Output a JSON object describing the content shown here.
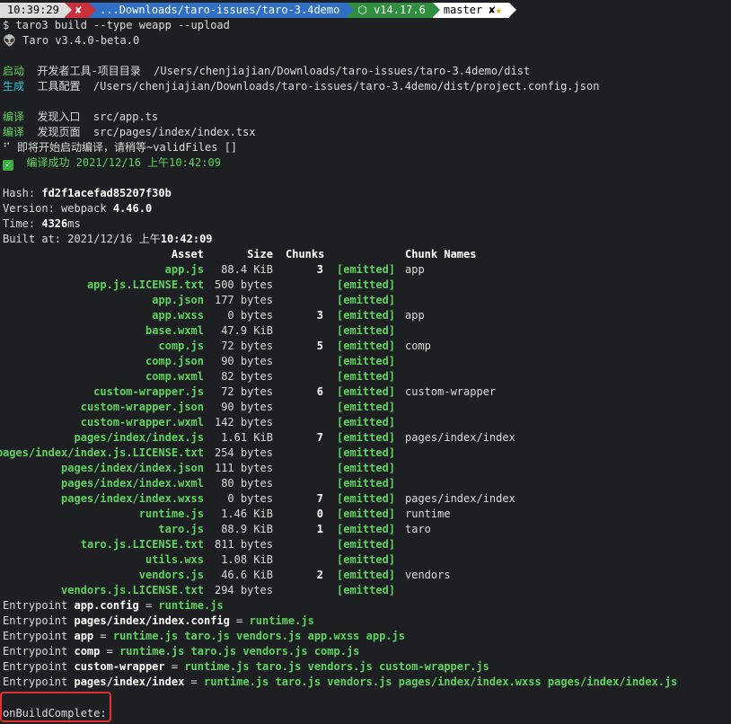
{
  "prompt": {
    "time": "10:39:29",
    "error_glyph": "✘",
    "path": "...Downloads/taro-issues/taro-3.4demo",
    "node_glyph": "⬡",
    "node_version": "v14.17.6",
    "branch_glyph": "",
    "branch": "master ✘",
    "star": "★"
  },
  "command": "$ taro3 build --type weapp --upload",
  "taro_version": "👽 Taro v3.4.0-beta.0",
  "launch": {
    "tag": "启动",
    "text": "  开发者工具-项目目录  /Users/chenjiajian/Downloads/taro-issues/taro-3.4demo/dist"
  },
  "generate": {
    "tag": "生成",
    "text": "  工具配置  /Users/chenjiajian/Downloads/taro-issues/taro-3.4demo/dist/project.config.json"
  },
  "compile1": {
    "tag": "编译",
    "text": "  发现入口  src/app.ts"
  },
  "compile2": {
    "tag": "编译",
    "text": "  发现页面  src/pages/index/index.tsx"
  },
  "waiting": "⠋ 即将开始启动编译，请稍等~validFiles []",
  "success": {
    "icon": "✓",
    "text": "  编译成功 2021/12/16 上午10:42:09"
  },
  "hash": {
    "label": "Hash: ",
    "value": "fd2f1acefad85207f30b"
  },
  "version": {
    "label": "Version: webpack ",
    "value": "4.46.0"
  },
  "time": {
    "label": "Time: ",
    "value": "4326",
    "unit": "ms"
  },
  "built": {
    "label": "Built at: 2021/12/16 上午",
    "value": "10:42:09"
  },
  "table": {
    "headers": {
      "asset": "Asset",
      "size": "Size",
      "chunks": "Chunks",
      "chunk_names": "Chunk Names"
    },
    "rows": [
      {
        "asset": "app.js",
        "size": "88.4 KiB",
        "chunks": "3",
        "emitted": "[emitted]",
        "name": "app"
      },
      {
        "asset": "app.js.LICENSE.txt",
        "size": "500 bytes",
        "chunks": "",
        "emitted": "[emitted]",
        "name": ""
      },
      {
        "asset": "app.json",
        "size": "177 bytes",
        "chunks": "",
        "emitted": "[emitted]",
        "name": ""
      },
      {
        "asset": "app.wxss",
        "size": "0 bytes",
        "chunks": "3",
        "emitted": "[emitted]",
        "name": "app"
      },
      {
        "asset": "base.wxml",
        "size": "47.9 KiB",
        "chunks": "",
        "emitted": "[emitted]",
        "name": ""
      },
      {
        "asset": "comp.js",
        "size": "72 bytes",
        "chunks": "5",
        "emitted": "[emitted]",
        "name": "comp"
      },
      {
        "asset": "comp.json",
        "size": "90 bytes",
        "chunks": "",
        "emitted": "[emitted]",
        "name": ""
      },
      {
        "asset": "comp.wxml",
        "size": "82 bytes",
        "chunks": "",
        "emitted": "[emitted]",
        "name": ""
      },
      {
        "asset": "custom-wrapper.js",
        "size": "72 bytes",
        "chunks": "6",
        "emitted": "[emitted]",
        "name": "custom-wrapper"
      },
      {
        "asset": "custom-wrapper.json",
        "size": "90 bytes",
        "chunks": "",
        "emitted": "[emitted]",
        "name": ""
      },
      {
        "asset": "custom-wrapper.wxml",
        "size": "142 bytes",
        "chunks": "",
        "emitted": "[emitted]",
        "name": ""
      },
      {
        "asset": "pages/index/index.js",
        "size": "1.61 KiB",
        "chunks": "7",
        "emitted": "[emitted]",
        "name": "pages/index/index"
      },
      {
        "asset": "pages/index/index.js.LICENSE.txt",
        "size": "254 bytes",
        "chunks": "",
        "emitted": "[emitted]",
        "name": ""
      },
      {
        "asset": "pages/index/index.json",
        "size": "111 bytes",
        "chunks": "",
        "emitted": "[emitted]",
        "name": ""
      },
      {
        "asset": "pages/index/index.wxml",
        "size": "80 bytes",
        "chunks": "",
        "emitted": "[emitted]",
        "name": ""
      },
      {
        "asset": "pages/index/index.wxss",
        "size": "0 bytes",
        "chunks": "7",
        "emitted": "[emitted]",
        "name": "pages/index/index"
      },
      {
        "asset": "runtime.js",
        "size": "1.46 KiB",
        "chunks": "0",
        "emitted": "[emitted]",
        "name": "runtime"
      },
      {
        "asset": "taro.js",
        "size": "88.9 KiB",
        "chunks": "1",
        "emitted": "[emitted]",
        "name": "taro"
      },
      {
        "asset": "taro.js.LICENSE.txt",
        "size": "811 bytes",
        "chunks": "",
        "emitted": "[emitted]",
        "name": ""
      },
      {
        "asset": "utils.wxs",
        "size": "1.08 KiB",
        "chunks": "",
        "emitted": "[emitted]",
        "name": ""
      },
      {
        "asset": "vendors.js",
        "size": "46.6 KiB",
        "chunks": "2",
        "emitted": "[emitted]",
        "name": "vendors"
      },
      {
        "asset": "vendors.js.LICENSE.txt",
        "size": "294 bytes",
        "chunks": "",
        "emitted": "[emitted]",
        "name": ""
      }
    ]
  },
  "entrypoints": [
    {
      "label": "Entrypoint ",
      "name": "app.config",
      "eq": " = ",
      "files": "runtime.js"
    },
    {
      "label": "Entrypoint ",
      "name": "pages/index/index.config",
      "eq": " = ",
      "files": "runtime.js"
    },
    {
      "label": "Entrypoint ",
      "name": "app",
      "eq": " = ",
      "files": "runtime.js taro.js vendors.js app.wxss app.js"
    },
    {
      "label": "Entrypoint ",
      "name": "comp",
      "eq": " = ",
      "files": "runtime.js taro.js vendors.js comp.js"
    },
    {
      "label": "Entrypoint ",
      "name": "custom-wrapper",
      "eq": " = ",
      "files": "runtime.js taro.js vendors.js custom-wrapper.js"
    },
    {
      "label": "Entrypoint ",
      "name": "pages/index/index",
      "eq": " = ",
      "files": "runtime.js taro.js vendors.js pages/index/index.wxss pages/index/index.js"
    }
  ],
  "build_complete": "onBuildComplete:",
  "colors": {
    "background": "#1e1f22",
    "green": "#5fd35f",
    "cyan": "#2ec5d3",
    "highlight": "#e0322f"
  }
}
